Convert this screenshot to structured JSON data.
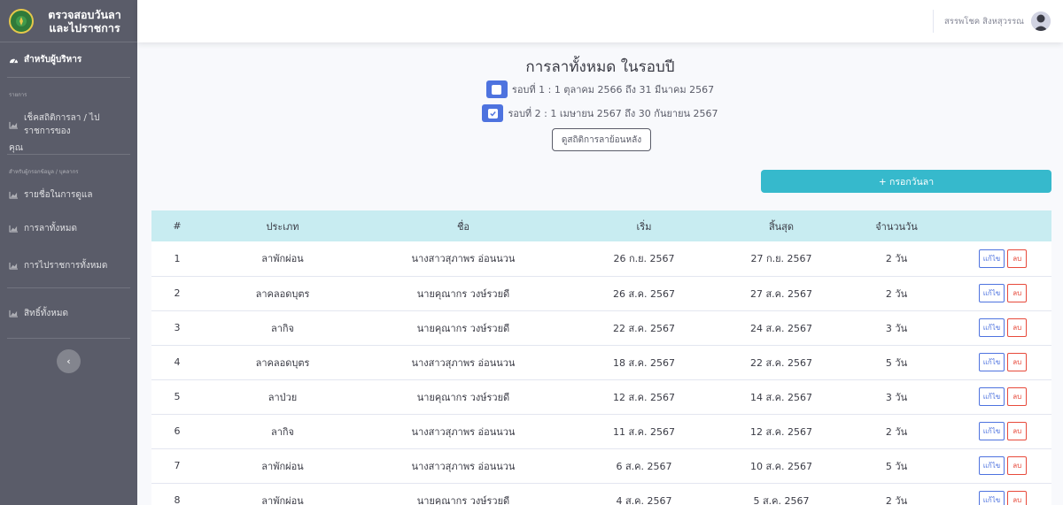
{
  "brand": {
    "line1": "ตรวจสอบวันลา",
    "line2": "และไปราชการ"
  },
  "sidebar": {
    "dashboard": "สำหรับผู้บริหาร",
    "heading1": "รายการ",
    "item_stats_1": "เช็คสถิติการลา / ไปราชการของ",
    "item_stats_2": "คุณ",
    "heading2": "สำหรับผู้กรอกข้อมูล / บุคลากร",
    "item_people": "รายชื่อในการดูแล",
    "item_all_leave": "การลาทั้งหมด",
    "item_all_official": "การไปราชการทั้งหมด",
    "item_rights": "สิทธิ์ทั้งหมด",
    "toggle": "‹"
  },
  "topbar": {
    "user_name": "สรรพโชค สิงหสุวรรณ"
  },
  "main": {
    "title": "การลาทั้งหมด ในรอบปี",
    "round1": "รอบที่ 1 : 1 ตุลาคม 2566 ถึง 31 มีนาคม 2567",
    "round2": "รอบที่ 2 : 1 เมษายน 2567 ถึง 30 กันยายน 2567",
    "round1_checked": false,
    "round2_checked": true,
    "history_button": "ดูสถิติการลาย้อนหลัง",
    "add_button": "+ กรอกวันลา"
  },
  "table": {
    "headers": [
      "#",
      "ประเภท",
      "ชื่อ",
      "เริ่ม",
      "สิ้นสุด",
      "จำนวนวัน",
      ""
    ],
    "edit_label": "แก้ไข",
    "delete_label": "ลบ",
    "rows": [
      [
        "1",
        "ลาพักผ่อน",
        "นางสาวสุภาพร อ่อนนวน",
        "26 ก.ย. 2567",
        "27 ก.ย. 2567",
        "2 วัน"
      ],
      [
        "2",
        "ลาคลอดบุตร",
        "นายคุณากร วงษ์รวยดี",
        "26 ส.ค. 2567",
        "27 ส.ค. 2567",
        "2 วัน"
      ],
      [
        "3",
        "ลากิจ",
        "นายคุณากร วงษ์รวยดี",
        "22 ส.ค. 2567",
        "24 ส.ค. 2567",
        "3 วัน"
      ],
      [
        "4",
        "ลาคลอดบุตร",
        "นางสาวสุภาพร อ่อนนวน",
        "18 ส.ค. 2567",
        "22 ส.ค. 2567",
        "5 วัน"
      ],
      [
        "5",
        "ลาป่วย",
        "นายคุณากร วงษ์รวยดี",
        "12 ส.ค. 2567",
        "14 ส.ค. 2567",
        "3 วัน"
      ],
      [
        "6",
        "ลากิจ",
        "นางสาวสุภาพร อ่อนนวน",
        "11 ส.ค. 2567",
        "12 ส.ค. 2567",
        "2 วัน"
      ],
      [
        "7",
        "ลาพักผ่อน",
        "นางสาวสุภาพร อ่อนนวน",
        "6 ส.ค. 2567",
        "10 ส.ค. 2567",
        "5 วัน"
      ],
      [
        "8",
        "ลาพักผ่อน",
        "นายคุณากร วงษ์รวยดี",
        "4 ส.ค. 2567",
        "5 ส.ค. 2567",
        "2 วัน"
      ]
    ]
  },
  "colors": {
    "sidebar": "#5a5c69",
    "primary": "#4e73df",
    "info": "#36b9cc",
    "danger": "#e74a3b",
    "table_head": "#c8ecf1"
  },
  "icons": {
    "dashboard": "tachometer-icon",
    "chart": "chart-area-icon",
    "check": "check-icon",
    "collapse": "chevron-left-icon"
  }
}
